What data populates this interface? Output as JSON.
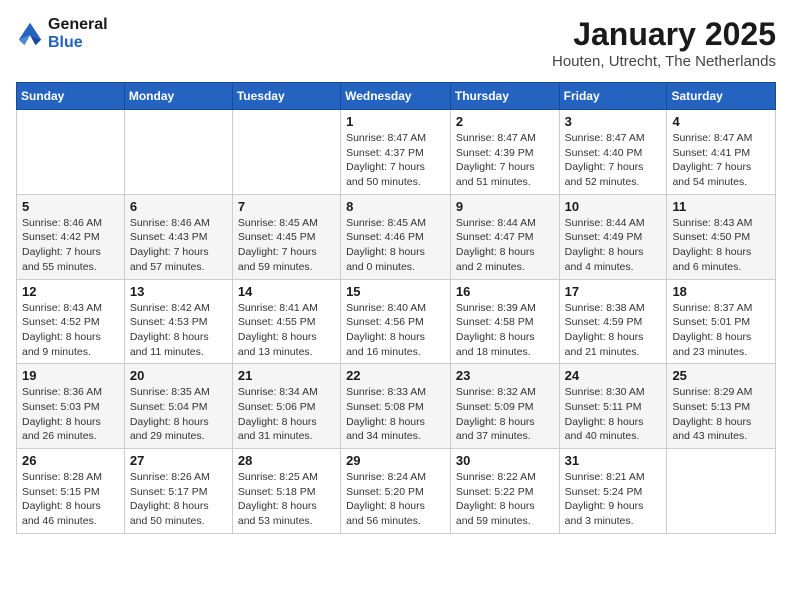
{
  "logo": {
    "general": "General",
    "blue": "Blue"
  },
  "title": {
    "month_year": "January 2025",
    "location": "Houten, Utrecht, The Netherlands"
  },
  "days_of_week": [
    "Sunday",
    "Monday",
    "Tuesday",
    "Wednesday",
    "Thursday",
    "Friday",
    "Saturday"
  ],
  "weeks": [
    [
      {
        "day": "",
        "info": ""
      },
      {
        "day": "",
        "info": ""
      },
      {
        "day": "",
        "info": ""
      },
      {
        "day": "1",
        "info": "Sunrise: 8:47 AM\nSunset: 4:37 PM\nDaylight: 7 hours\nand 50 minutes."
      },
      {
        "day": "2",
        "info": "Sunrise: 8:47 AM\nSunset: 4:39 PM\nDaylight: 7 hours\nand 51 minutes."
      },
      {
        "day": "3",
        "info": "Sunrise: 8:47 AM\nSunset: 4:40 PM\nDaylight: 7 hours\nand 52 minutes."
      },
      {
        "day": "4",
        "info": "Sunrise: 8:47 AM\nSunset: 4:41 PM\nDaylight: 7 hours\nand 54 minutes."
      }
    ],
    [
      {
        "day": "5",
        "info": "Sunrise: 8:46 AM\nSunset: 4:42 PM\nDaylight: 7 hours\nand 55 minutes."
      },
      {
        "day": "6",
        "info": "Sunrise: 8:46 AM\nSunset: 4:43 PM\nDaylight: 7 hours\nand 57 minutes."
      },
      {
        "day": "7",
        "info": "Sunrise: 8:45 AM\nSunset: 4:45 PM\nDaylight: 7 hours\nand 59 minutes."
      },
      {
        "day": "8",
        "info": "Sunrise: 8:45 AM\nSunset: 4:46 PM\nDaylight: 8 hours\nand 0 minutes."
      },
      {
        "day": "9",
        "info": "Sunrise: 8:44 AM\nSunset: 4:47 PM\nDaylight: 8 hours\nand 2 minutes."
      },
      {
        "day": "10",
        "info": "Sunrise: 8:44 AM\nSunset: 4:49 PM\nDaylight: 8 hours\nand 4 minutes."
      },
      {
        "day": "11",
        "info": "Sunrise: 8:43 AM\nSunset: 4:50 PM\nDaylight: 8 hours\nand 6 minutes."
      }
    ],
    [
      {
        "day": "12",
        "info": "Sunrise: 8:43 AM\nSunset: 4:52 PM\nDaylight: 8 hours\nand 9 minutes."
      },
      {
        "day": "13",
        "info": "Sunrise: 8:42 AM\nSunset: 4:53 PM\nDaylight: 8 hours\nand 11 minutes."
      },
      {
        "day": "14",
        "info": "Sunrise: 8:41 AM\nSunset: 4:55 PM\nDaylight: 8 hours\nand 13 minutes."
      },
      {
        "day": "15",
        "info": "Sunrise: 8:40 AM\nSunset: 4:56 PM\nDaylight: 8 hours\nand 16 minutes."
      },
      {
        "day": "16",
        "info": "Sunrise: 8:39 AM\nSunset: 4:58 PM\nDaylight: 8 hours\nand 18 minutes."
      },
      {
        "day": "17",
        "info": "Sunrise: 8:38 AM\nSunset: 4:59 PM\nDaylight: 8 hours\nand 21 minutes."
      },
      {
        "day": "18",
        "info": "Sunrise: 8:37 AM\nSunset: 5:01 PM\nDaylight: 8 hours\nand 23 minutes."
      }
    ],
    [
      {
        "day": "19",
        "info": "Sunrise: 8:36 AM\nSunset: 5:03 PM\nDaylight: 8 hours\nand 26 minutes."
      },
      {
        "day": "20",
        "info": "Sunrise: 8:35 AM\nSunset: 5:04 PM\nDaylight: 8 hours\nand 29 minutes."
      },
      {
        "day": "21",
        "info": "Sunrise: 8:34 AM\nSunset: 5:06 PM\nDaylight: 8 hours\nand 31 minutes."
      },
      {
        "day": "22",
        "info": "Sunrise: 8:33 AM\nSunset: 5:08 PM\nDaylight: 8 hours\nand 34 minutes."
      },
      {
        "day": "23",
        "info": "Sunrise: 8:32 AM\nSunset: 5:09 PM\nDaylight: 8 hours\nand 37 minutes."
      },
      {
        "day": "24",
        "info": "Sunrise: 8:30 AM\nSunset: 5:11 PM\nDaylight: 8 hours\nand 40 minutes."
      },
      {
        "day": "25",
        "info": "Sunrise: 8:29 AM\nSunset: 5:13 PM\nDaylight: 8 hours\nand 43 minutes."
      }
    ],
    [
      {
        "day": "26",
        "info": "Sunrise: 8:28 AM\nSunset: 5:15 PM\nDaylight: 8 hours\nand 46 minutes."
      },
      {
        "day": "27",
        "info": "Sunrise: 8:26 AM\nSunset: 5:17 PM\nDaylight: 8 hours\nand 50 minutes."
      },
      {
        "day": "28",
        "info": "Sunrise: 8:25 AM\nSunset: 5:18 PM\nDaylight: 8 hours\nand 53 minutes."
      },
      {
        "day": "29",
        "info": "Sunrise: 8:24 AM\nSunset: 5:20 PM\nDaylight: 8 hours\nand 56 minutes."
      },
      {
        "day": "30",
        "info": "Sunrise: 8:22 AM\nSunset: 5:22 PM\nDaylight: 8 hours\nand 59 minutes."
      },
      {
        "day": "31",
        "info": "Sunrise: 8:21 AM\nSunset: 5:24 PM\nDaylight: 9 hours\nand 3 minutes."
      },
      {
        "day": "",
        "info": ""
      }
    ]
  ]
}
